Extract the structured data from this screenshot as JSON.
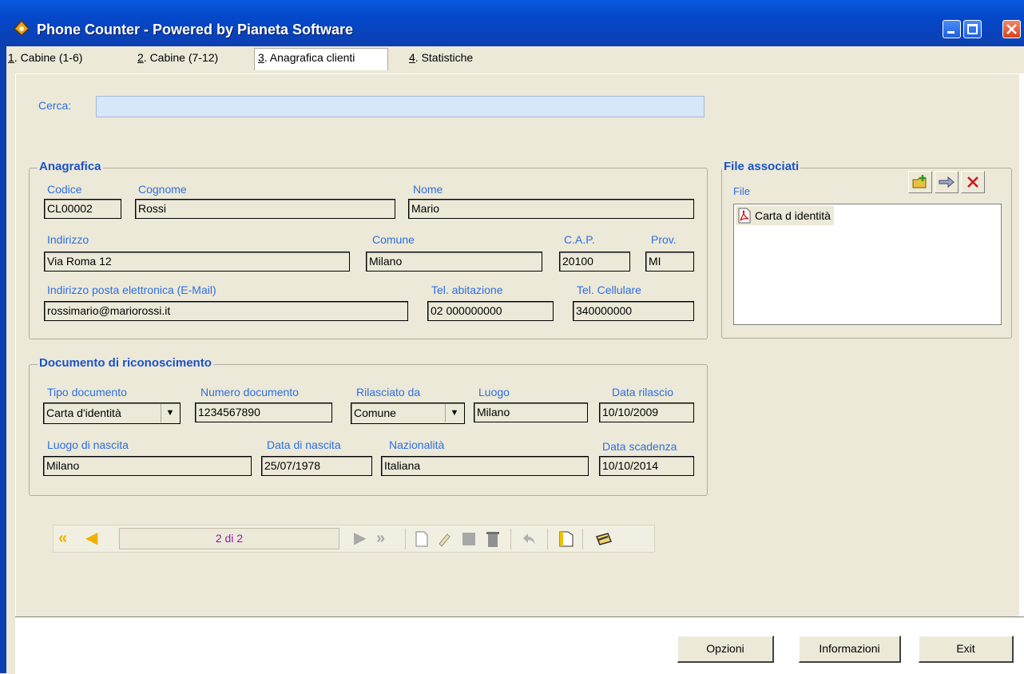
{
  "window": {
    "title": "Phone Counter - Powered by Pianeta Software"
  },
  "tabs": [
    {
      "key": "1",
      "rest": ". Cabine (1-6)"
    },
    {
      "key": "2",
      "rest": ". Cabine (7-12)"
    },
    {
      "key": "3",
      "rest": ". Anagrafica clienti"
    },
    {
      "key": "4",
      "rest": ". Statistiche"
    }
  ],
  "search": {
    "label": "Cerca:",
    "value": ""
  },
  "anagrafica": {
    "title": "Anagrafica",
    "codice_label": "Codice",
    "codice": "CL00002",
    "cognome_label": "Cognome",
    "cognome": "Rossi",
    "nome_label": "Nome",
    "nome": "Mario",
    "indirizzo_label": "Indirizzo",
    "indirizzo": "Via Roma 12",
    "comune_label": "Comune",
    "comune": "Milano",
    "cap_label": "C.A.P.",
    "cap": "20100",
    "prov_label": "Prov.",
    "prov": "MI",
    "email_label": "Indirizzo posta elettronica (E-Mail)",
    "email": "rossimario@mariorossi.it",
    "tel_ab_label": "Tel. abitazione",
    "tel_ab": "02 000000000",
    "tel_cell_label": "Tel. Cellulare",
    "tel_cell": "340000000"
  },
  "documento": {
    "title": "Documento di riconoscimento",
    "tipo_label": "Tipo documento",
    "tipo": "Carta d'identità",
    "numero_label": "Numero documento",
    "numero": "1234567890",
    "rilasciato_label": "Rilasciato da",
    "rilasciato": "Comune",
    "luogo_label": "Luogo",
    "luogo": "Milano",
    "data_rilascio_label": "Data rilascio",
    "data_rilascio": "10/10/2009",
    "luogo_nascita_label": "Luogo di nascita",
    "luogo_nascita": "Milano",
    "data_nascita_label": "Data di nascita",
    "data_nascita": "25/07/1978",
    "nazionalita_label": "Nazionalità",
    "nazionalita": "Italiana",
    "data_scadenza_label": "Data scadenza",
    "data_scadenza": "10/10/2014"
  },
  "files": {
    "title": "File associati",
    "column_label": "File",
    "items": [
      "Carta d identità"
    ]
  },
  "navigator": {
    "counter": "2 di 2"
  },
  "buttons": {
    "opzioni": "Opzioni",
    "informazioni": "Informazioni",
    "exit": "Exit"
  },
  "colors": {
    "titlebar": "#0447c8",
    "label_blue": "#2e6fe0",
    "group_title": "#1c52c8",
    "counter_text": "#8b1fa8"
  }
}
